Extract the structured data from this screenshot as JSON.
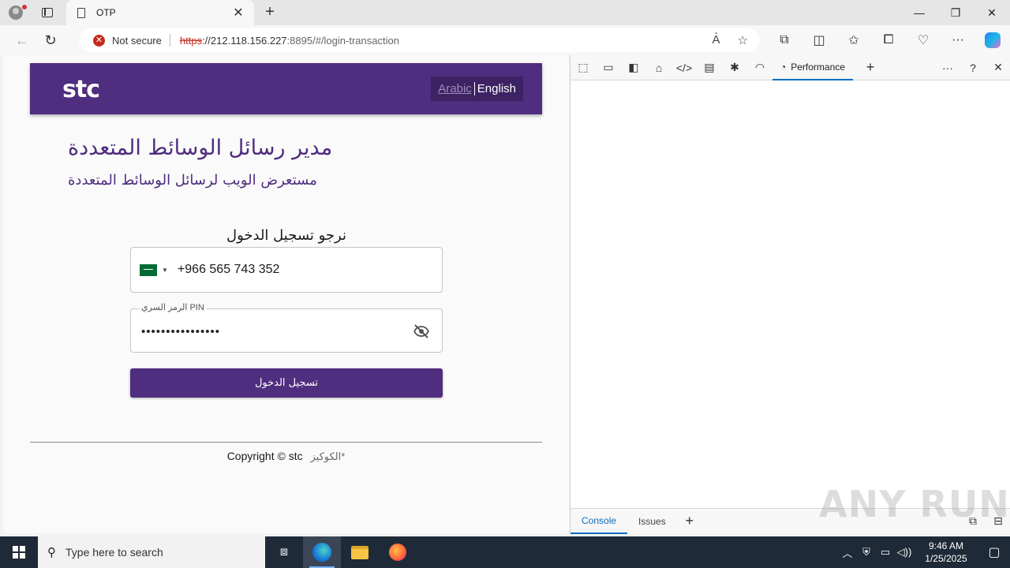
{
  "browser": {
    "tab_title": "OTP",
    "tab_close": "✕",
    "new_tab": "+",
    "window": {
      "minimize": "—",
      "restore": "❐",
      "close": "✕"
    },
    "security_label": "Not secure",
    "url_scheme": "https",
    "url_host": "://212.118.156.227",
    "url_port": ":8895",
    "url_path": "/#/login-transaction"
  },
  "page": {
    "logo": "stc",
    "lang_arabic": "Arabic",
    "lang_english": "English",
    "title": "مدير رسائل الوسائط المتعددة",
    "subtitle": "مستعرض الويب لرسائل الوسائط المتعددة",
    "login_prompt": "نرجو تسجيل الدخول",
    "phone_value": "+966 565 743 352",
    "pin_label": "الرمز السري PIN",
    "pin_value": "••••••••••••••••",
    "login_button": "تسجيل الدخول",
    "copyright": "Copyright © stc",
    "cookies": "الكوكيز*"
  },
  "devtools": {
    "active_tab": "Performance",
    "drawer_tabs": [
      "Console",
      "Issues"
    ]
  },
  "watermark": "ANY RUN",
  "taskbar": {
    "search_placeholder": "Type here to search",
    "time": "9:46 AM",
    "date": "1/25/2025"
  },
  "colors": {
    "brand": "#4f2d7f",
    "not_secure": "#c42b1c",
    "devtools_accent": "#0f6cbd"
  }
}
